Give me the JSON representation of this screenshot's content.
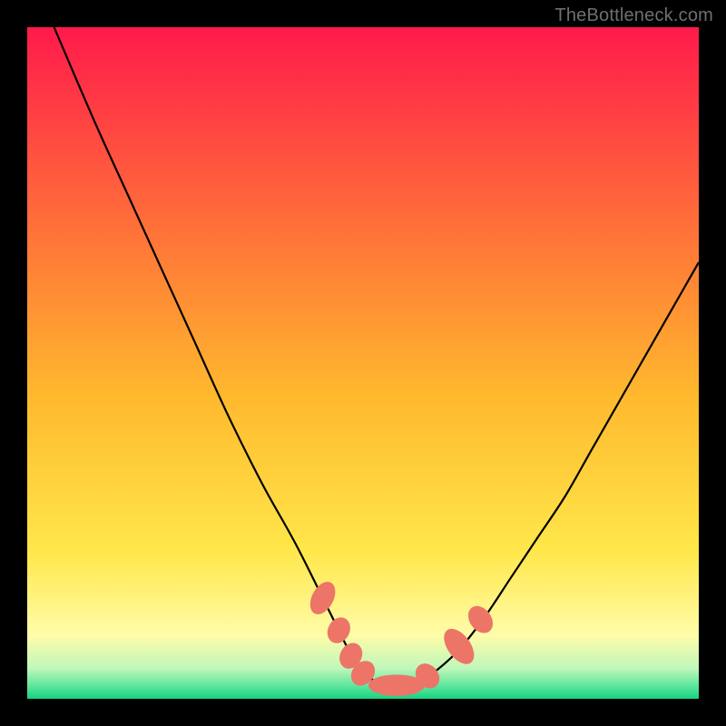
{
  "watermark": "TheBottleneck.com",
  "colors": {
    "frame": "#000000",
    "curve": "#000000",
    "marker": "#ec7568",
    "gradient_stops": [
      {
        "offset": 0.0,
        "color": "#ff1a4b"
      },
      {
        "offset": 0.28,
        "color": "#ff6b3a"
      },
      {
        "offset": 0.55,
        "color": "#ffb92e"
      },
      {
        "offset": 0.78,
        "color": "#ffe74a"
      },
      {
        "offset": 0.905,
        "color": "#fffca8"
      },
      {
        "offset": 0.955,
        "color": "#bff7ba"
      },
      {
        "offset": 0.985,
        "color": "#4de397"
      },
      {
        "offset": 1.0,
        "color": "#17d37e"
      }
    ]
  },
  "chart_data": {
    "type": "line",
    "title": "",
    "xlabel": "",
    "ylabel": "",
    "xlim": [
      0,
      100
    ],
    "ylim": [
      0,
      100
    ],
    "grid": false,
    "legend": false,
    "series": [
      {
        "name": "bottleneck-curve",
        "x": [
          4.0,
          10,
          15,
          20,
          25,
          30,
          35,
          40,
          45,
          48,
          50,
          52,
          54,
          56,
          58,
          60,
          64,
          68,
          72,
          76,
          80,
          84,
          88,
          92,
          96,
          100
        ],
        "y": [
          100,
          86,
          75,
          64,
          53,
          42,
          32,
          23,
          13,
          7,
          4,
          2.5,
          2,
          2,
          2.5,
          3.5,
          7,
          12,
          18,
          24,
          30,
          37,
          44,
          51,
          58,
          65
        ]
      }
    ],
    "markers": [
      {
        "x": 44.0,
        "y": 15.0,
        "rx": 1.6,
        "ry": 2.6,
        "rot": 28
      },
      {
        "x": 46.4,
        "y": 10.2,
        "rx": 1.6,
        "ry": 2.0,
        "rot": 28
      },
      {
        "x": 48.2,
        "y": 6.4,
        "rx": 1.6,
        "ry": 2.0,
        "rot": 28
      },
      {
        "x": 50.0,
        "y": 3.8,
        "rx": 1.6,
        "ry": 2.0,
        "rot": 40
      },
      {
        "x": 55.0,
        "y": 2.0,
        "rx": 4.2,
        "ry": 1.6,
        "rot": 0
      },
      {
        "x": 59.6,
        "y": 3.4,
        "rx": 1.6,
        "ry": 2.0,
        "rot": -40
      },
      {
        "x": 64.3,
        "y": 7.8,
        "rx": 1.7,
        "ry": 3.0,
        "rot": -36
      },
      {
        "x": 67.5,
        "y": 11.8,
        "rx": 1.6,
        "ry": 2.2,
        "rot": -36
      }
    ]
  }
}
